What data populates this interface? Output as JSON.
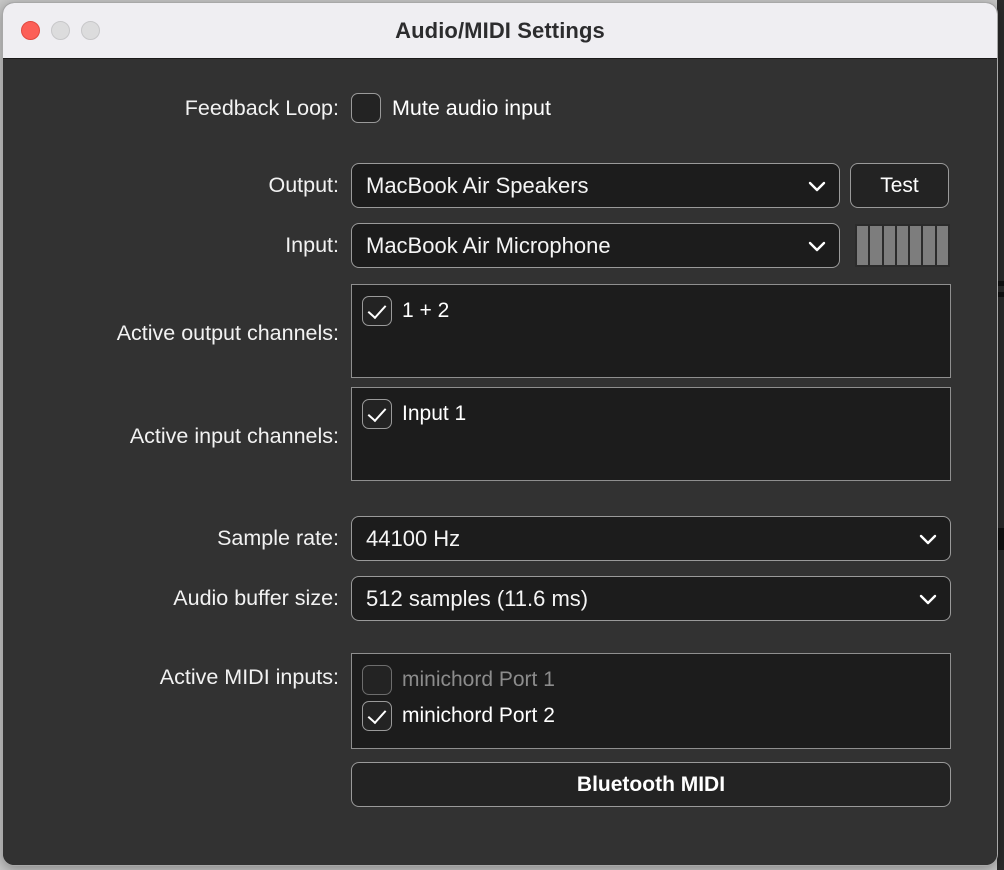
{
  "window": {
    "title": "Audio/MIDI Settings",
    "traffic_lights": [
      "close-button",
      "minimize-button",
      "maximize-button"
    ],
    "accent_close": "#fc5f57",
    "titlebar_bg": "#efeef2",
    "content_bg": "#323232"
  },
  "feedback_loop": {
    "label": "Feedback Loop:",
    "mute_label": "Mute audio input",
    "mute_checked": false
  },
  "output": {
    "label": "Output:",
    "value": "MacBook Air Speakers",
    "test_label": "Test"
  },
  "input": {
    "label": "Input:",
    "value": "MacBook Air Microphone",
    "meter_segments": 7
  },
  "active_output_channels": {
    "label": "Active output channels:",
    "items": [
      {
        "label": "1 + 2",
        "checked": true,
        "enabled": true
      }
    ]
  },
  "active_input_channels": {
    "label": "Active input channels:",
    "items": [
      {
        "label": "Input 1",
        "checked": true,
        "enabled": true
      }
    ]
  },
  "sample_rate": {
    "label": "Sample rate:",
    "value": "44100 Hz"
  },
  "buffer_size": {
    "label": "Audio buffer size:",
    "value": "512 samples (11.6 ms)"
  },
  "active_midi_inputs": {
    "label": "Active MIDI inputs:",
    "items": [
      {
        "label": "minichord Port 1",
        "checked": false,
        "enabled": false
      },
      {
        "label": "minichord Port 2",
        "checked": true,
        "enabled": true
      }
    ]
  },
  "bluetooth_midi": {
    "label": "Bluetooth MIDI"
  }
}
